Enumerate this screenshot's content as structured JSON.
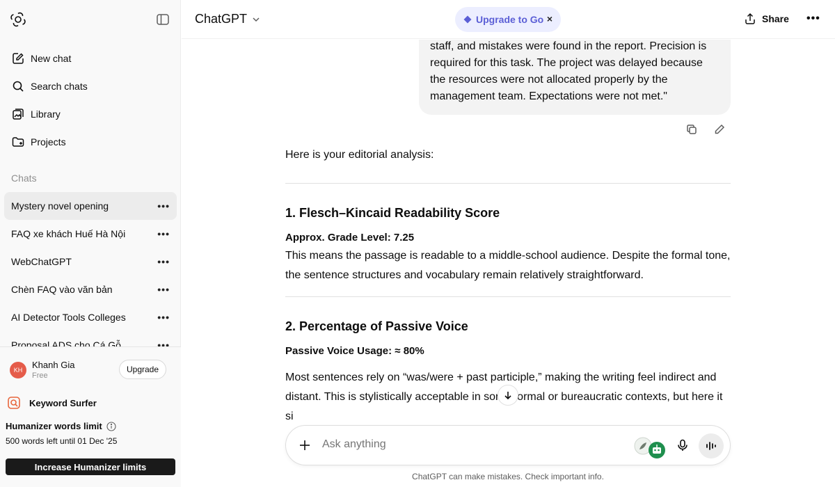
{
  "sidebar": {
    "nav": [
      "New chat",
      "Search chats",
      "Library",
      "Projects"
    ],
    "chats_label": "Chats",
    "chats": [
      "Mystery novel opening",
      "FAQ xe khách Huế Hà Nội",
      "WebChatGPT",
      "Chèn FAQ vào văn bản",
      "AI Detector Tools Colleges",
      "Proposal ADS cho Cá Gỗ"
    ],
    "user": {
      "initials": "KH",
      "name": "Khanh Gia",
      "plan": "Free",
      "upgrade": "Upgrade"
    },
    "keyword_surfer": "Keyword Surfer",
    "humanizer": {
      "title": "Humanizer words limit",
      "text": "500 words left until 01 Dec '25",
      "button": "Increase Humanizer limits"
    }
  },
  "topbar": {
    "model": "ChatGPT",
    "promo": "Upgrade to Go",
    "promo_close": "×",
    "share": "Share",
    "more": "•••"
  },
  "user_message": "staff, and mistakes were found in the report. Precision is required for this task. The project was delayed because the resources were not allocated properly by the management team. Expectations were not met.\"",
  "answer": {
    "intro": "Here is your editorial analysis:",
    "s1_title": "1. Flesch–Kincaid Readability Score",
    "s1_grade": "Approx. Grade Level: 7.25",
    "s1_text": "This means the passage is readable to a middle-school audience. Despite the formal tone, the sentence structures and vocabulary remain relatively straightforward.",
    "s2_title": "2. Percentage of Passive Voice",
    "s2_usage": "Passive Voice Usage: ≈ 80%",
    "s2_text": "Most sentences rely on “was/were + past participle,” making the writing feel indirect and distant. This is stylistically acceptable in some formal or bureaucratic contexts, but here it si"
  },
  "composer": {
    "placeholder": "Ask anything"
  },
  "footer": "ChatGPT can make mistakes. Check important info."
}
